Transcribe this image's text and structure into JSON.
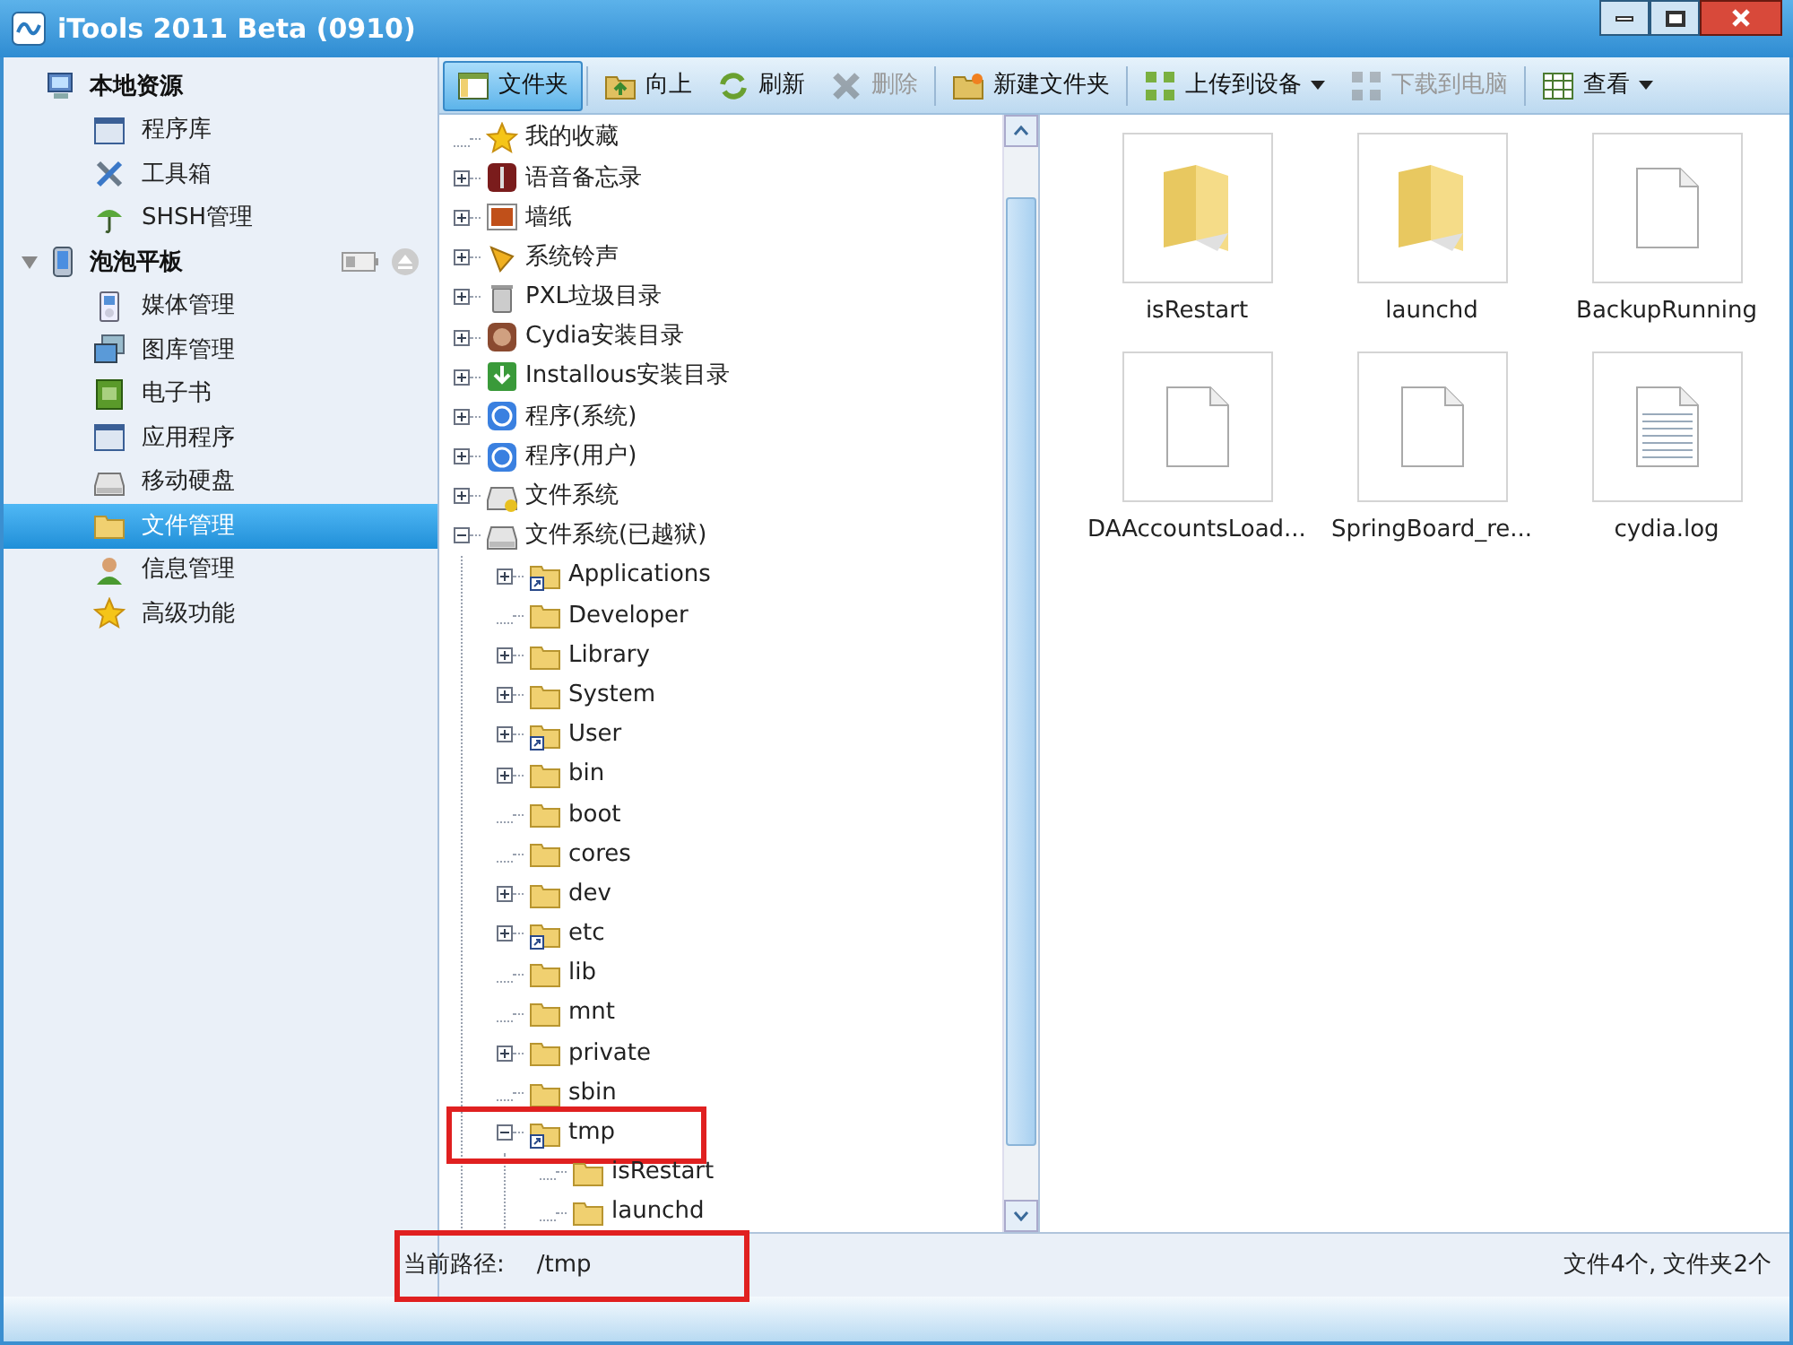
{
  "window": {
    "title": "iTools 2011 Beta (0910)"
  },
  "sidebar": {
    "groups": [
      {
        "label": "本地资源",
        "kind": "local",
        "items": [
          {
            "label": "程序库",
            "selected": false
          },
          {
            "label": "工具箱",
            "selected": false
          },
          {
            "label": "SHSH管理",
            "selected": false
          }
        ]
      },
      {
        "label": "泡泡平板",
        "kind": "device",
        "expanded": true,
        "items": [
          {
            "label": "媒体管理",
            "selected": false
          },
          {
            "label": "图库管理",
            "selected": false
          },
          {
            "label": "电子书",
            "selected": false
          },
          {
            "label": "应用程序",
            "selected": false
          },
          {
            "label": "移动硬盘",
            "selected": false
          },
          {
            "label": "文件管理",
            "selected": true
          },
          {
            "label": "信息管理",
            "selected": false
          },
          {
            "label": "高级功能",
            "selected": false
          }
        ]
      }
    ]
  },
  "toolbar": [
    {
      "label": "文件夹",
      "selected": true,
      "disabled": false,
      "dropdown": false,
      "separator_after": true
    },
    {
      "label": "向上",
      "selected": false,
      "disabled": false,
      "dropdown": false,
      "separator_after": false
    },
    {
      "label": "刷新",
      "selected": false,
      "disabled": false,
      "dropdown": false,
      "separator_after": false
    },
    {
      "label": "删除",
      "selected": false,
      "disabled": true,
      "dropdown": false,
      "separator_after": true
    },
    {
      "label": "新建文件夹",
      "selected": false,
      "disabled": false,
      "dropdown": false,
      "separator_after": true
    },
    {
      "label": "上传到设备",
      "selected": false,
      "disabled": false,
      "dropdown": true,
      "separator_after": false
    },
    {
      "label": "下载到电脑",
      "selected": false,
      "disabled": true,
      "dropdown": false,
      "separator_after": true
    },
    {
      "label": "查看",
      "selected": false,
      "disabled": false,
      "dropdown": true,
      "separator_after": false
    }
  ],
  "tree": [
    {
      "label": "我的收藏",
      "leaf": true,
      "expanded": false,
      "highlighted": false
    },
    {
      "label": "语音备忘录",
      "leaf": false,
      "expanded": false,
      "highlighted": false
    },
    {
      "label": "墙纸",
      "leaf": false,
      "expanded": false,
      "highlighted": false
    },
    {
      "label": "系统铃声",
      "leaf": false,
      "expanded": false,
      "highlighted": false
    },
    {
      "label": "PXL垃圾目录",
      "leaf": false,
      "expanded": false,
      "highlighted": false
    },
    {
      "label": "Cydia安装目录",
      "leaf": false,
      "expanded": false,
      "highlighted": false
    },
    {
      "label": "Installous安装目录",
      "leaf": false,
      "expanded": false,
      "highlighted": false
    },
    {
      "label": "程序(系统)",
      "leaf": false,
      "expanded": false,
      "highlighted": false
    },
    {
      "label": "程序(用户)",
      "leaf": false,
      "expanded": false,
      "highlighted": false
    },
    {
      "label": "文件系统",
      "leaf": false,
      "expanded": false,
      "highlighted": false
    },
    {
      "label": "文件系统(已越狱)",
      "leaf": false,
      "expanded": true,
      "highlighted": false,
      "children": [
        {
          "label": "Applications",
          "kind": "shortcut",
          "leaf": false,
          "expanded": false,
          "highlighted": false
        },
        {
          "label": "Developer",
          "kind": "folder",
          "leaf": true,
          "expanded": false,
          "highlighted": false
        },
        {
          "label": "Library",
          "kind": "folder",
          "leaf": false,
          "expanded": false,
          "highlighted": false
        },
        {
          "label": "System",
          "kind": "folder",
          "leaf": false,
          "expanded": false,
          "highlighted": false
        },
        {
          "label": "User",
          "kind": "shortcut",
          "leaf": false,
          "expanded": false,
          "highlighted": false
        },
        {
          "label": "bin",
          "kind": "folder",
          "leaf": false,
          "expanded": false,
          "highlighted": false
        },
        {
          "label": "boot",
          "kind": "folder",
          "leaf": true,
          "expanded": false,
          "highlighted": false
        },
        {
          "label": "cores",
          "kind": "folder",
          "leaf": true,
          "expanded": false,
          "highlighted": false
        },
        {
          "label": "dev",
          "kind": "folder",
          "leaf": false,
          "expanded": false,
          "highlighted": false
        },
        {
          "label": "etc",
          "kind": "shortcut",
          "leaf": false,
          "expanded": false,
          "highlighted": false
        },
        {
          "label": "lib",
          "kind": "folder",
          "leaf": true,
          "expanded": false,
          "highlighted": false
        },
        {
          "label": "mnt",
          "kind": "folder",
          "leaf": true,
          "expanded": false,
          "highlighted": false
        },
        {
          "label": "private",
          "kind": "folder",
          "leaf": false,
          "expanded": false,
          "highlighted": false
        },
        {
          "label": "sbin",
          "kind": "folder",
          "leaf": true,
          "expanded": false,
          "highlighted": false
        },
        {
          "label": "tmp",
          "kind": "shortcut",
          "leaf": false,
          "expanded": true,
          "highlighted": true,
          "children": [
            {
              "label": "isRestart",
              "kind": "folder",
              "leaf": true,
              "expanded": false,
              "highlighted": false
            },
            {
              "label": "launchd",
              "kind": "folder",
              "leaf": true,
              "expanded": false,
              "highlighted": false
            }
          ]
        }
      ]
    }
  ],
  "files": [
    {
      "name": "isRestart",
      "kind": "folder"
    },
    {
      "name": "launchd",
      "kind": "folder"
    },
    {
      "name": "BackupRunning",
      "kind": "file"
    },
    {
      "name": "DAAccountsLoad...",
      "kind": "file"
    },
    {
      "name": "SpringBoard_re...",
      "kind": "file"
    },
    {
      "name": "cydia.log",
      "kind": "text"
    }
  ],
  "status_bar": {
    "path_label": "当前路径:",
    "path": "/tmp",
    "path_highlighted": true,
    "summary": "文件4个, 文件夹2个"
  }
}
